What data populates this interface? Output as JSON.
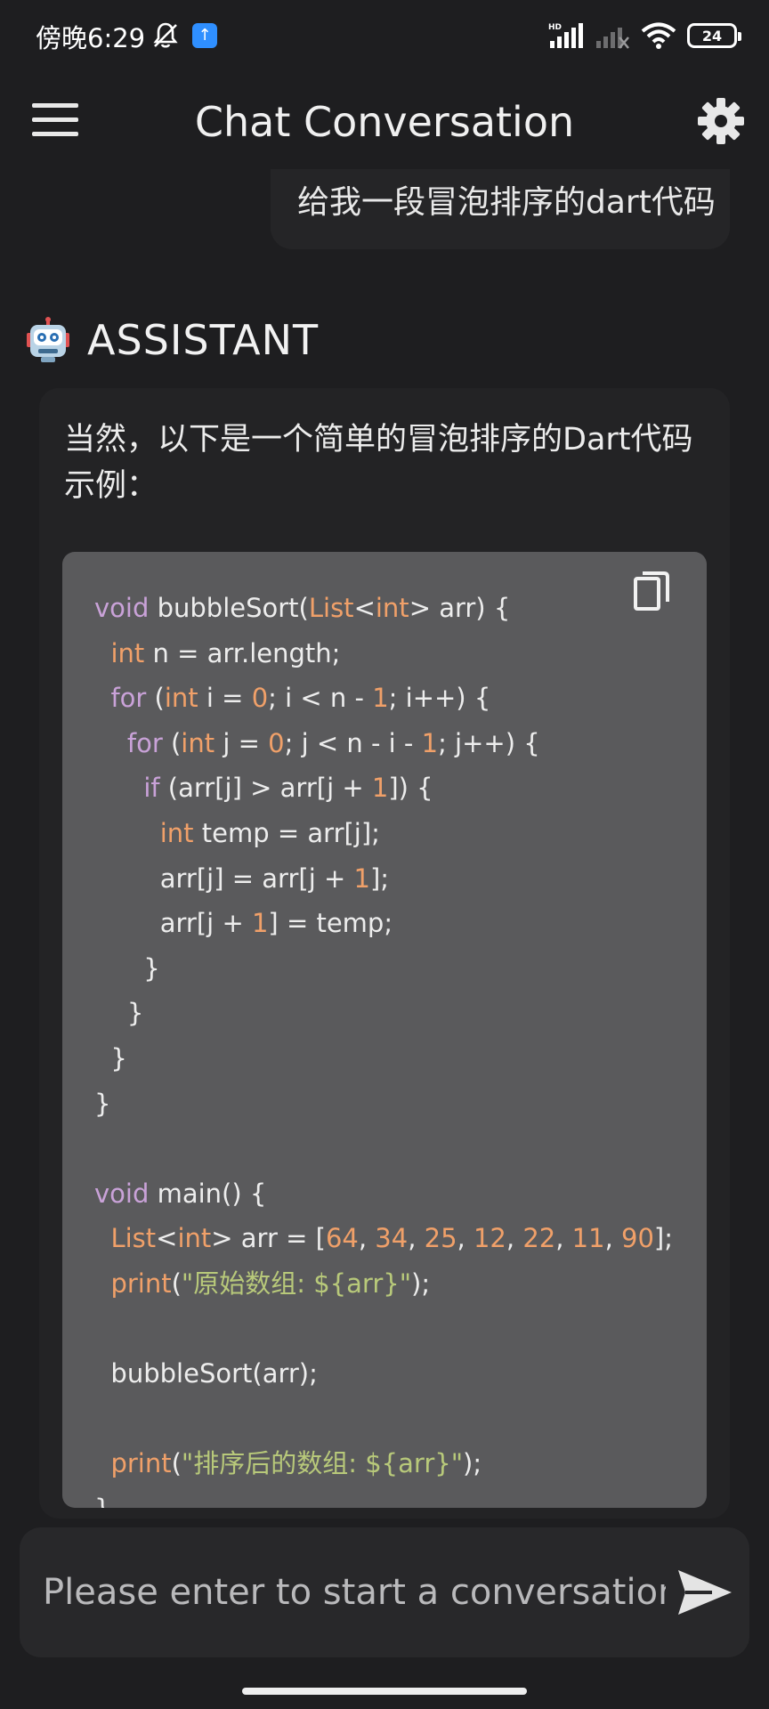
{
  "status_bar": {
    "time": "傍晚6:29",
    "battery": "24",
    "upload_icon": "upload-arrow-icon",
    "signal_icons": [
      "hd-signal-icon",
      "no-signal-icon",
      "wifi-icon"
    ]
  },
  "app_bar": {
    "title": "Chat Conversation",
    "menu_icon": "hamburger-menu-icon",
    "settings_icon": "gear-icon"
  },
  "user_message": {
    "text": "给我一段冒泡排序的dart代码"
  },
  "assistant": {
    "label": "ASSISTANT",
    "avatar_icon": "robot-icon",
    "intro": "当然，以下是一个简单的冒泡排序的Dart代码示例：",
    "code_lines": [
      "void bubbleSort(List<int> arr) {",
      "  int n = arr.length;",
      "  for (int i = 0; i < n - 1; i++) {",
      "    for (int j = 0; j < n - i - 1; j++) {",
      "      if (arr[j] > arr[j + 1]) {",
      "        int temp = arr[j];",
      "        arr[j] = arr[j + 1];",
      "        arr[j + 1] = temp;",
      "      }",
      "    }",
      "  }",
      "}",
      "",
      "void main() {",
      "  List<int> arr = [64, 34, 25, 12, 22, 11, 90];",
      "  print(\"原始数组: ${arr}\");",
      "",
      "  bubbleSort(arr);",
      "",
      "  print(\"排序后的数组: ${arr}\");",
      "}"
    ],
    "copy_icon": "copy-icon"
  },
  "input": {
    "placeholder": "Please enter to start a conversation",
    "value": "",
    "send_icon": "send-icon"
  },
  "colors": {
    "background": "#1e1e20",
    "code_background": "#5a5a5c",
    "keyword": "#c9a2d8",
    "type_number": "#f0a069",
    "string": "#b8c97a"
  }
}
